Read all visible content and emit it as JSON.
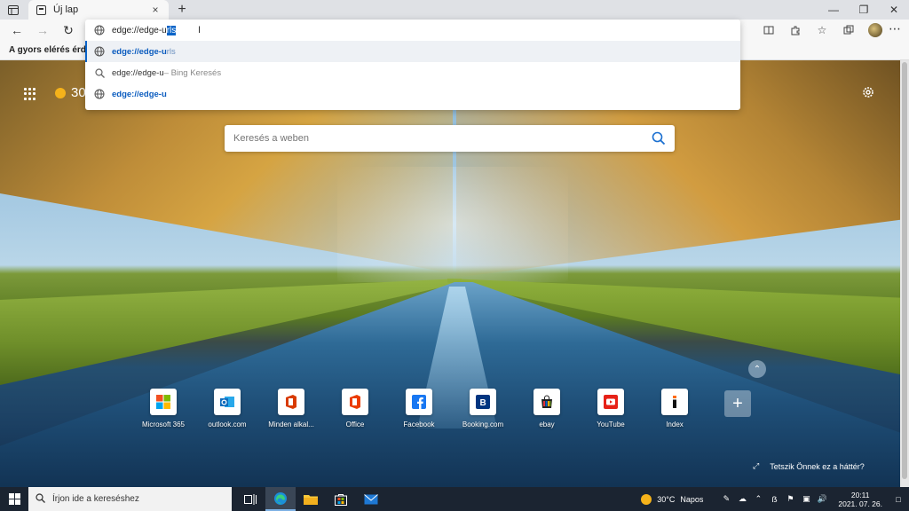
{
  "browser": {
    "tab_title": "Új lap",
    "tab_close": "×",
    "new_tab": "+",
    "favorites_text": "A gyors elérés érdekébe"
  },
  "address_bar": {
    "typed": "edge://edge-u",
    "autocomplete_selected": "rls"
  },
  "suggestions": [
    {
      "main": "edge://edge-u",
      "rest": "rls",
      "icon": "globe-icon",
      "active": true
    },
    {
      "plain": "edge://edge-u",
      "dim": " – Bing Keresés",
      "icon": "search-icon",
      "active": false
    },
    {
      "main": "edge://edge-u",
      "rest": "",
      "icon": "globe-icon",
      "active": false
    }
  ],
  "ntp": {
    "weather_partial": "30",
    "search_placeholder": "Keresés a weben",
    "background_prompt": "Tetszik Önnek ez a háttér?",
    "tiles": [
      {
        "label": "Microsoft 365",
        "icon": "microsoft-365-icon"
      },
      {
        "label": "outlook.com",
        "icon": "outlook-icon"
      },
      {
        "label": "Minden alkal...",
        "icon": "office-apps-icon"
      },
      {
        "label": "Office",
        "icon": "office-icon"
      },
      {
        "label": "Facebook",
        "icon": "facebook-icon"
      },
      {
        "label": "Booking.com",
        "icon": "booking-icon"
      },
      {
        "label": "ebay",
        "icon": "ebay-icon"
      },
      {
        "label": "YouTube",
        "icon": "youtube-icon"
      },
      {
        "label": "Index",
        "icon": "index-icon"
      }
    ]
  },
  "taskbar": {
    "search_placeholder": "Írjon ide a kereséshez",
    "weather_temp": "30°C",
    "weather_desc": "Napos",
    "time": "20:11",
    "date": "2021. 07. 26."
  },
  "colors": {
    "accent": "#0a64c8",
    "taskbar": "#1b2431"
  }
}
